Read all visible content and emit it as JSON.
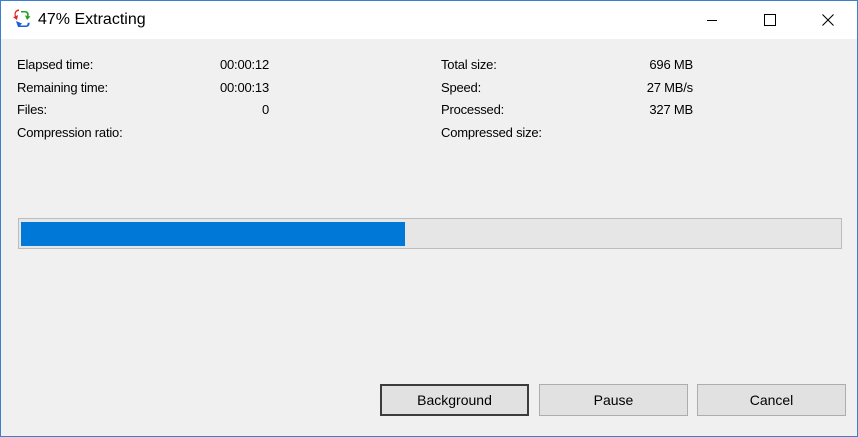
{
  "window": {
    "title": "47% Extracting",
    "icon": "recycle-arrows-icon",
    "accent_color": "#0078d7",
    "border_color": "#3c7fd1"
  },
  "titlebar_buttons": {
    "minimize": "minimize-icon",
    "maximize": "maximize-icon",
    "close": "close-icon"
  },
  "stats_left": [
    {
      "label": "Elapsed time:",
      "value": "00:00:12"
    },
    {
      "label": "Remaining time:",
      "value": "00:00:13"
    },
    {
      "label": "Files:",
      "value": "0"
    },
    {
      "label": "Compression ratio:",
      "value": ""
    }
  ],
  "stats_right": [
    {
      "label": "Total size:",
      "value": "696 MB"
    },
    {
      "label": "Speed:",
      "value": "27 MB/s"
    },
    {
      "label": "Processed:",
      "value": "327 MB"
    },
    {
      "label": "Compressed size:",
      "value": ""
    }
  ],
  "progress": {
    "percent": 47
  },
  "buttons": {
    "background": "Background",
    "pause": "Pause",
    "cancel": "Cancel"
  }
}
